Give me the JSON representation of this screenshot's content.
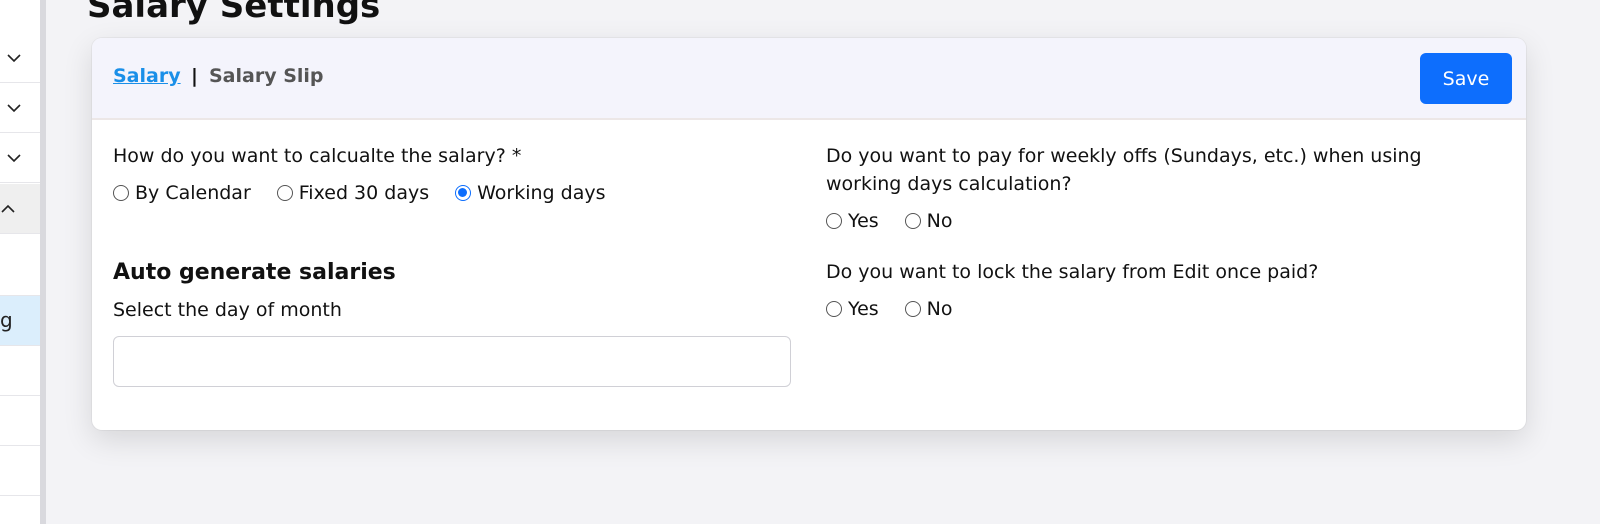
{
  "page": {
    "title": "Salary Settings"
  },
  "sidebar": {
    "partial_label": "g"
  },
  "header": {
    "tabs": [
      "Salary",
      "Salary Slip"
    ],
    "separator": "|",
    "save_label": "Save"
  },
  "calc": {
    "question": "How do you want to calcualte the salary? *",
    "options": [
      "By Calendar",
      "Fixed 30 days",
      "Working days"
    ],
    "selected": "Working days"
  },
  "weekly_offs": {
    "question": "Do you want to pay for weekly offs (Sundays, etc.) when using working days calculation?",
    "options": [
      "Yes",
      "No"
    ],
    "selected": null
  },
  "lock": {
    "question": "Do you want to lock the salary from Edit once paid?",
    "options": [
      "Yes",
      "No"
    ],
    "selected": null
  },
  "auto_generate": {
    "title": "Auto generate salaries",
    "label": "Select the day of month",
    "value": ""
  },
  "colors": {
    "accent": "#0d6efd",
    "link": "#1a8fe8",
    "header_bg": "#f4f4fc"
  }
}
